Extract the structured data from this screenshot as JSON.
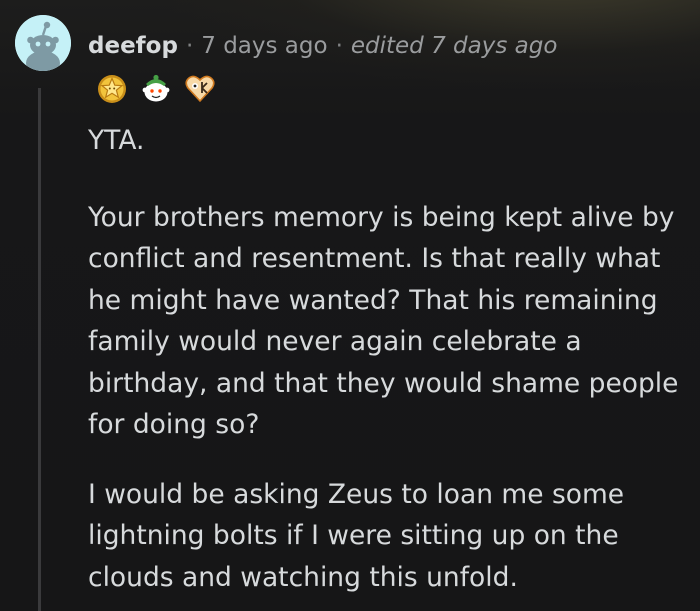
{
  "comment": {
    "author": "deefop",
    "separator": "·",
    "timestamp": "7 days ago",
    "edited": "edited 7 days ago",
    "awards": [
      {
        "icon": "star-award-icon"
      },
      {
        "icon": "snoo-award-icon"
      },
      {
        "icon": "heart-award-icon"
      }
    ],
    "paragraphs": [
      "YTA.",
      "Your brothers memory is being kept alive by conflict and resentment. Is that really what he might have wanted? That his remaining family would never again celebrate a birthday, and that they would shame people for doing so?",
      "I would be asking Zeus to loan me some lightning bolts if I were sitting up on the clouds and watching this unfold."
    ]
  },
  "colors": {
    "background": "#161617",
    "text": "#d7dadc",
    "meta_text": "#9a9c9e",
    "avatar_bg": "#c5f1f7",
    "thread_line": "#3a3a3c"
  }
}
